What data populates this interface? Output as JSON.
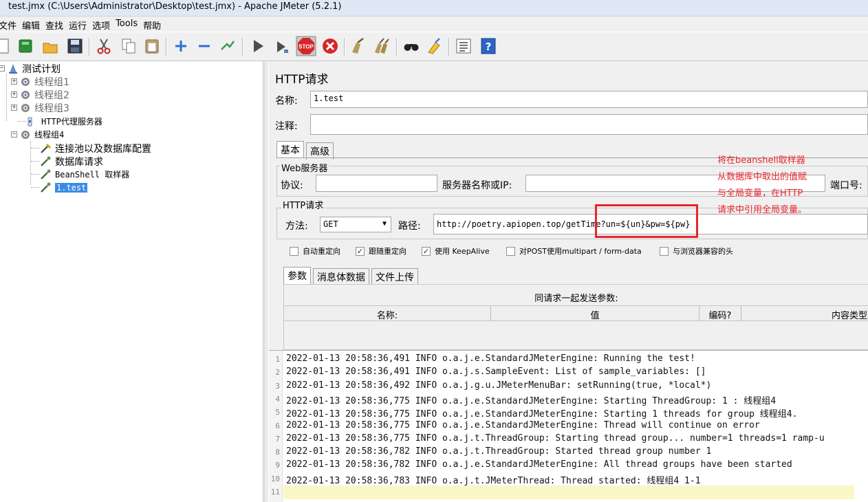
{
  "window": {
    "title": "test.jmx (C:\\Users\\Administrator\\Desktop\\test.jmx) - Apache JMeter (5.2.1)"
  },
  "menu": [
    "文件",
    "编辑",
    "查找",
    "运行",
    "选项",
    "Tools",
    "帮助"
  ],
  "toolbar": {
    "icons": [
      "new-icon",
      "templates-icon",
      "open-icon",
      "save-icon",
      "cut-icon",
      "copy-icon",
      "paste-icon",
      "expand-icon",
      "collapse-icon",
      "toggle-icon",
      "start-icon",
      "start-no-pauses-icon",
      "stop-icon",
      "shutdown-icon",
      "clear-icon",
      "clear-all-icon",
      "search-icon",
      "reset-search-icon",
      "function-helper-icon",
      "help-icon"
    ],
    "stop_text": "STOP",
    "help_text": "?"
  },
  "tree": {
    "root": "测试计划",
    "items": [
      {
        "label": "线程组1"
      },
      {
        "label": "线程组2"
      },
      {
        "label": "线程组3"
      },
      {
        "label": "HTTP代理服务器"
      },
      {
        "label": "线程组4"
      },
      {
        "label": "连接池以及数据库配置"
      },
      {
        "label": "数据库请求"
      },
      {
        "label": "BeanShell 取样器"
      },
      {
        "label": "1.test"
      }
    ]
  },
  "panel": {
    "title": "HTTP请求",
    "name_label": "名称:",
    "name_value": "1.test",
    "comment_label": "注释:",
    "comment_value": "",
    "tabs": [
      "基本",
      "高级"
    ],
    "web_server": {
      "title": "Web服务器",
      "protocol_label": "协议:",
      "protocol_value": "",
      "server_label": "服务器名称或IP:",
      "server_value": "",
      "port_label": "端口号:"
    },
    "http_request": {
      "title": "HTTP请求",
      "method_label": "方法:",
      "method_value": "GET",
      "path_label": "路径:",
      "path_value": "http://poetry.apiopen.top/getTime?un=${un}&pw=${pw}"
    },
    "checkboxes": [
      {
        "label": "自动重定向",
        "checked": false
      },
      {
        "label": "跟随重定向",
        "checked": true
      },
      {
        "label": "使用 KeepAlive",
        "checked": true
      },
      {
        "label": "对POST使用multipart / form-data",
        "checked": false
      },
      {
        "label": "与浏览器兼容的头",
        "checked": false
      }
    ],
    "sub_tabs": [
      "参数",
      "消息体数据",
      "文件上传"
    ],
    "params": {
      "caption": "同请求一起发送参数:",
      "columns": [
        "名称:",
        "值",
        "编码?",
        "内容类型"
      ]
    }
  },
  "annotation": {
    "text": "将在beanshell取样器从数据库中取出的值赋与全局变量，在HTTP请求中引用全局变量。",
    "color": "#e8262b"
  },
  "log": {
    "lines": [
      "2022-01-13 20:58:36,491 INFO o.a.j.e.StandardJMeterEngine: Running the test!",
      "2022-01-13 20:58:36,491 INFO o.a.j.s.SampleEvent: List of sample_variables: []",
      "2022-01-13 20:58:36,492 INFO o.a.j.g.u.JMeterMenuBar: setRunning(true, *local*)",
      "2022-01-13 20:58:36,775 INFO o.a.j.e.StandardJMeterEngine: Starting ThreadGroup: 1 : 线程组4",
      "2022-01-13 20:58:36,775 INFO o.a.j.e.StandardJMeterEngine: Starting 1 threads for group 线程组4.",
      "2022-01-13 20:58:36,775 INFO o.a.j.e.StandardJMeterEngine: Thread will continue on error",
      "2022-01-13 20:58:36,775 INFO o.a.j.t.ThreadGroup: Starting thread group... number=1 threads=1 ramp-u",
      "2022-01-13 20:58:36,782 INFO o.a.j.t.ThreadGroup: Started thread group number 1",
      "2022-01-13 20:58:36,782 INFO o.a.j.e.StandardJMeterEngine: All thread groups have been started",
      "2022-01-13 20:58:36,783 INFO o.a.j.t.JMeterThread: Thread started: 线程组4 1-1",
      ""
    ],
    "line_numbers": [
      "1",
      "2",
      "3",
      "4",
      "5",
      "6",
      "7",
      "8",
      "9",
      "10",
      "11"
    ]
  }
}
